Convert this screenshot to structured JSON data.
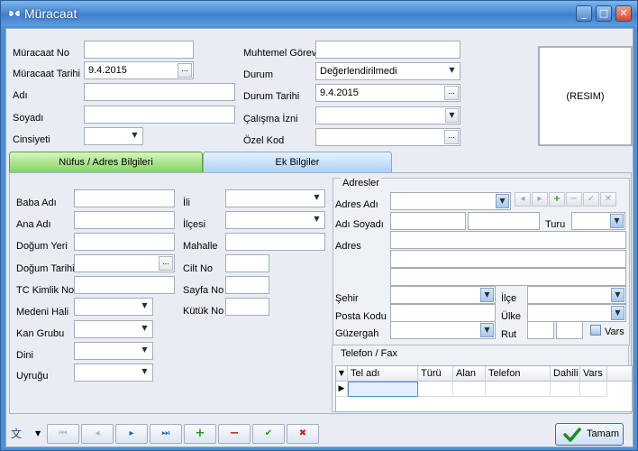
{
  "window": {
    "title": "Müracaat",
    "minimize": "_",
    "maximize": "□",
    "close": "✕"
  },
  "header": {
    "muracaat_no_label": "Müracaat No",
    "muracaat_no_value": "",
    "muracaat_tarihi_label": "Müracaat Tarihi",
    "muracaat_tarihi_value": "9.4.2015",
    "adi_label": "Adı",
    "adi_value": "",
    "soyadi_label": "Soyadı",
    "soyadi_value": "",
    "cinsiyeti_label": "Cinsiyeti",
    "cinsiyeti_value": "",
    "muhtemel_gorev_label": "Muhtemel Görev",
    "muhtemel_gorev_value": "",
    "durum_label": "Durum",
    "durum_value": "Değerlendirilmedi",
    "durum_tarihi_label": "Durum Tarihi",
    "durum_tarihi_value": "9.4.2015",
    "calisma_izni_label": "Çalışma İzni",
    "calisma_izni_value": "",
    "ozel_kod_label": "Özel Kod",
    "ozel_kod_value": "",
    "photo_label": "(RESIM)",
    "ellipsis": "..."
  },
  "tabs": [
    {
      "label": "Nüfus / Adres Bilgileri",
      "active": true
    },
    {
      "label": "Ek Bilgiler",
      "active": false
    }
  ],
  "nufus": {
    "baba_adi": "Baba Adı",
    "ana_adi": "Ana Adı",
    "dogum_yeri": "Doğum Yeri",
    "dogum_tarihi": "Doğum Tarihi",
    "tc_kimlik_no": "TC Kimlik No",
    "medeni_hali": "Medeni Hali",
    "kan_grubu": "Kan Grubu",
    "dini": "Dini",
    "uyrugu": "Uyruğu",
    "ili": "İli",
    "ilcesi": "İlçesi",
    "mahalle": "Mahalle",
    "cilt_no": "Cilt No",
    "sayfa_no": "Sayfa No",
    "kutuk_no": "Kütük No"
  },
  "adresler": {
    "title": "Adresler",
    "adres_adi": "Adres Adı",
    "adi_soyadi": "Adı Soyadı",
    "turu": "Turu",
    "adres": "Adres",
    "sehir": "Şehir",
    "ilce": "İlçe",
    "posta_kodu": "Posta Kodu",
    "ulke": "Ülke",
    "guzergah": "Güzergah",
    "rut": "Rut",
    "vars": "Vars"
  },
  "telefon": {
    "title": "Telefon / Fax",
    "columns": [
      "Tel adı",
      "Türü",
      "Alan",
      "Telefon",
      "Dahili",
      "Vars"
    ]
  },
  "footer": {
    "ok_label": "Tamam"
  }
}
